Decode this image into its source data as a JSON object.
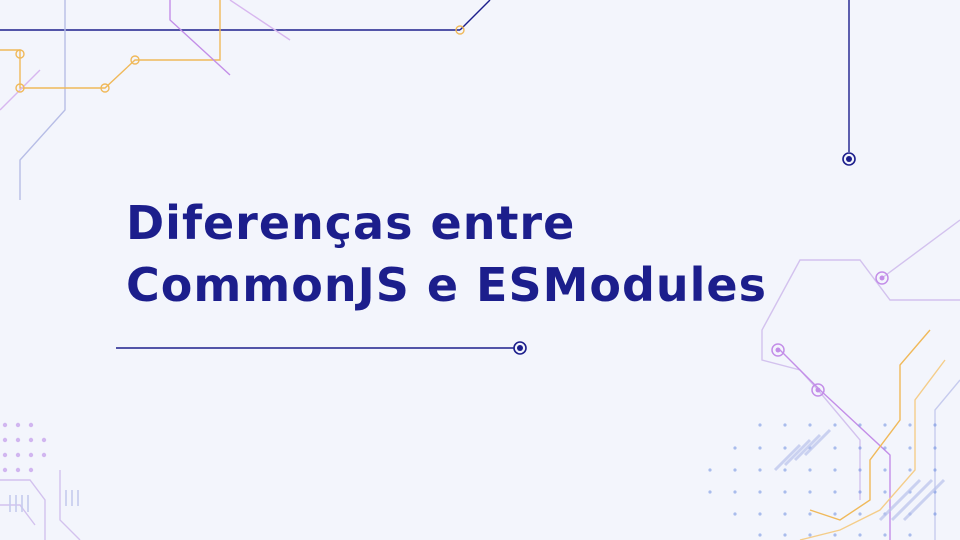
{
  "slide": {
    "title_line1": "Diferenças entre",
    "title_line2": "CommonJS e ESModules"
  },
  "colors": {
    "background": "#f3f5fc",
    "title": "#1c1e8c",
    "line_dark": "#1c1e8c",
    "purple": "#c38ee8",
    "orange": "#f0b95a",
    "blue_dots": "#6e8fe0"
  }
}
